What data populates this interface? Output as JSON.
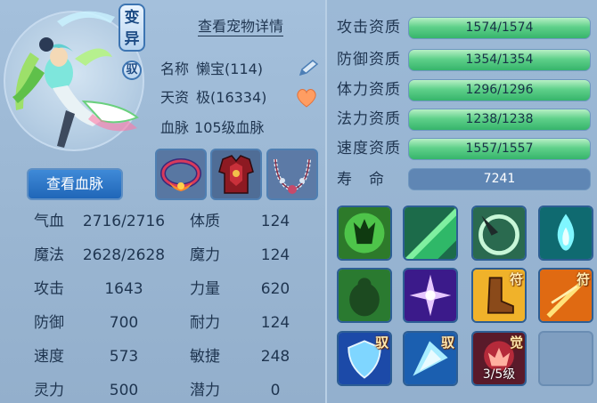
{
  "pet": {
    "mutant_badge": "变异",
    "tame_badge": "驭",
    "detail_link": "查看宠物详情",
    "name_label": "名称",
    "name_value": "懒宝(114)",
    "talent_label": "天资",
    "talent_value": "极(16334)",
    "bloodline_label": "血脉",
    "bloodline_value": "105级血脉",
    "view_bloodline_button": "查看血脉"
  },
  "equipment": [
    {
      "icon": "collar-icon"
    },
    {
      "icon": "armor-icon"
    },
    {
      "icon": "necklace-icon"
    }
  ],
  "stats_left": [
    {
      "label": "气血",
      "value": "2716/2716"
    },
    {
      "label": "魔法",
      "value": "2628/2628"
    },
    {
      "label": "攻击",
      "value": "1643"
    },
    {
      "label": "防御",
      "value": "700"
    },
    {
      "label": "速度",
      "value": "573"
    },
    {
      "label": "灵力",
      "value": "500"
    }
  ],
  "stats_right": [
    {
      "label": "体质",
      "value": "124"
    },
    {
      "label": "魔力",
      "value": "124"
    },
    {
      "label": "力量",
      "value": "620"
    },
    {
      "label": "耐力",
      "value": "124"
    },
    {
      "label": "敏捷",
      "value": "248"
    },
    {
      "label": "潜力",
      "value": "0"
    }
  ],
  "aptitudes": [
    {
      "label": "攻击资质",
      "value": "1574/1574",
      "fill": 1.0
    },
    {
      "label": "防御资质",
      "value": "1354/1354",
      "fill": 1.0
    },
    {
      "label": "体力资质",
      "value": "1296/1296",
      "fill": 1.0
    },
    {
      "label": "法力资质",
      "value": "1238/1238",
      "fill": 1.0
    },
    {
      "label": "速度资质",
      "value": "1557/1557",
      "fill": 1.0
    }
  ],
  "life": {
    "label": "寿　命",
    "value": "7241"
  },
  "skills": [
    {
      "icon": "green-demon-skill-icon",
      "tag": ""
    },
    {
      "icon": "green-light-skill-icon",
      "tag": ""
    },
    {
      "icon": "whirlwind-claw-skill-icon",
      "tag": ""
    },
    {
      "icon": "cyan-flame-skill-icon",
      "tag": ""
    },
    {
      "icon": "green-giant-skill-icon",
      "tag": ""
    },
    {
      "icon": "purple-burst-skill-icon",
      "tag": ""
    },
    {
      "icon": "boot-skill-icon",
      "tag": "符"
    },
    {
      "icon": "fire-blade-skill-icon",
      "tag": "符"
    },
    {
      "icon": "blue-shield-skill-icon",
      "tag": "驭"
    },
    {
      "icon": "ice-shard-skill-icon",
      "tag": "驭"
    },
    {
      "icon": "awaken-skill-icon",
      "tag": "觉",
      "level": "3/5级"
    },
    {
      "icon": "empty-slot",
      "tag": ""
    }
  ],
  "colors": {
    "bar_fill": "#4fc67c",
    "button_blue": "#2f7acb",
    "text": "#1f3550"
  }
}
